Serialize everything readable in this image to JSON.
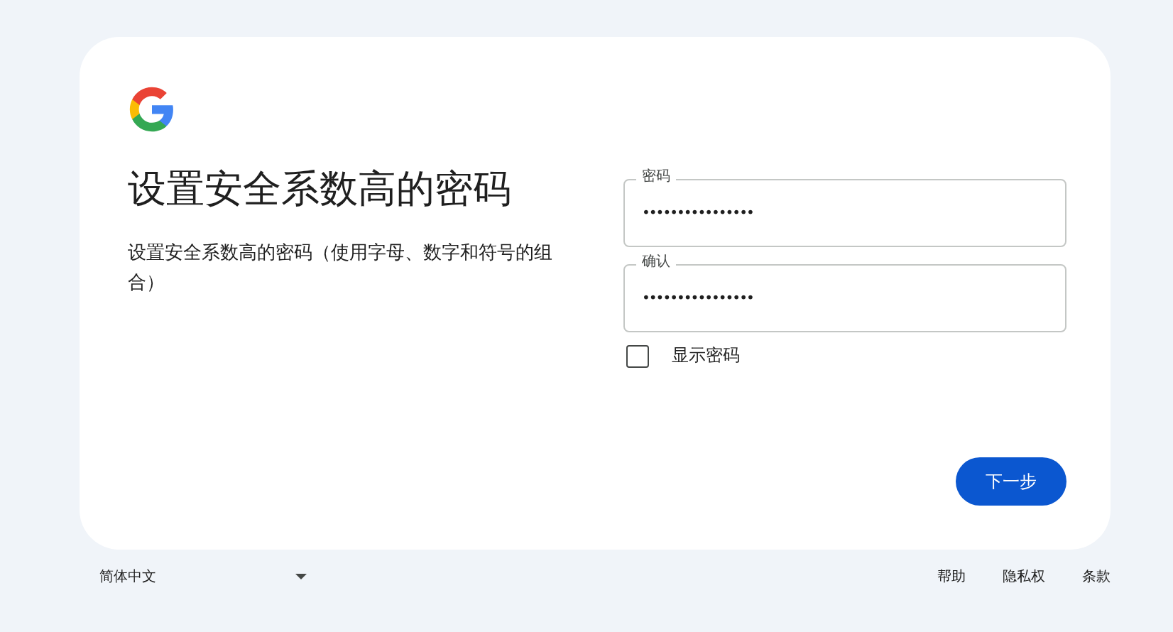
{
  "card": {
    "title": "设置安全系数高的密码",
    "description": "设置安全系数高的密码（使用字母、数字和符号的组合）",
    "fields": [
      {
        "label": "密码",
        "value": "••••••••••••••••"
      },
      {
        "label": "确认",
        "value": "••••••••••••••••"
      }
    ],
    "show_password": {
      "label": "显示密码",
      "checked": false
    },
    "next_button": "下一步"
  },
  "footer": {
    "language": "简体中文",
    "links": [
      "帮助",
      "隐私权",
      "条款"
    ]
  }
}
